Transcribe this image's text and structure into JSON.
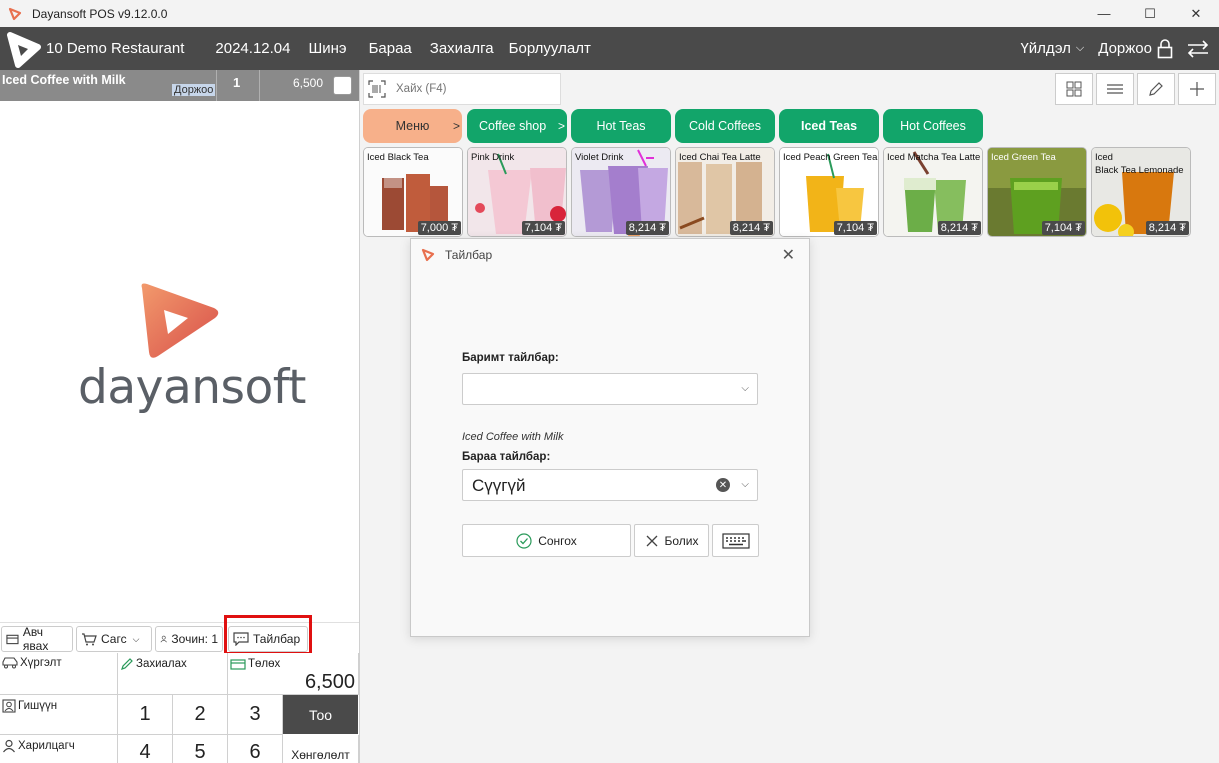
{
  "window": {
    "title": "Dayansoft POS v9.12.0.0",
    "minimize": "—",
    "maximize": "☐",
    "close": "✕"
  },
  "nav": {
    "restaurant": "10 Demo Restaurant",
    "date": "2024.12.04",
    "items": [
      "Шинэ",
      "Бараа",
      "Захиалга",
      "Борлуулалт"
    ],
    "operation": "Үйлдэл",
    "user": "Доржоо"
  },
  "order": {
    "item_name": "Iced Coffee with Milk",
    "waiter": "Доржоо",
    "qty": "1",
    "price": "6,500"
  },
  "brand": {
    "word": "dayansoft"
  },
  "actions": {
    "takeaway": "Авч явах",
    "cart": "Сагс",
    "guest": "Зочин: 1",
    "note": "Тайлбар"
  },
  "pad": {
    "delivery": "Хүргэлт",
    "order": "Захиалах",
    "pay": "Төлөх",
    "total": "6,500",
    "member": "Гишүүн",
    "customer": "Харилцагч",
    "qty_btn": "Тоо",
    "discount_btn": "Хөнгөлөлт",
    "keys": [
      "1",
      "2",
      "3",
      "4",
      "5",
      "6"
    ]
  },
  "search": {
    "placeholder": "Хайх (F4)"
  },
  "categories": [
    {
      "label": "Меню",
      "color": "#f7b08a"
    },
    {
      "label": "Coffee shop",
      "color": "#12a56a"
    },
    {
      "label": "Hot Teas",
      "color": "#12a56a"
    },
    {
      "label": "Cold Coffees",
      "color": "#12a56a"
    },
    {
      "label": "Iced Teas",
      "color": "#12a56a"
    },
    {
      "label": "Hot Coffees",
      "color": "#12a56a"
    }
  ],
  "category_arrow": ">",
  "products": [
    {
      "name": "Iced Black Tea",
      "price": "7,000 ₮"
    },
    {
      "name": "Pink Drink",
      "price": "7,104 ₮"
    },
    {
      "name": "Violet Drink",
      "price": "8,214 ₮"
    },
    {
      "name": "Iced Chai Tea Latte",
      "price": "8,214 ₮"
    },
    {
      "name": "Iced Peach Green Tea",
      "price": "7,104 ₮"
    },
    {
      "name": "Iced Matcha Tea Latte",
      "price": "8,214 ₮"
    },
    {
      "name": "Iced Green Tea",
      "price": "7,104 ₮"
    },
    {
      "name": "Iced\nBlack Tea Lemonade",
      "price": "8,214 ₮"
    }
  ],
  "dialog": {
    "title": "Тайлбар",
    "receipt_label": "Баримт тайлбар:",
    "item_name": "Iced Coffee with Milk",
    "item_label": "Бараа тайлбар:",
    "item_value": "Сүүгүй",
    "select_btn": "Сонгох",
    "cancel_btn": "Болих"
  },
  "colors": {
    "accent": "#e8704f",
    "green": "#12a56a",
    "dark": "#4a4a4a",
    "highlight": "#e01010"
  }
}
